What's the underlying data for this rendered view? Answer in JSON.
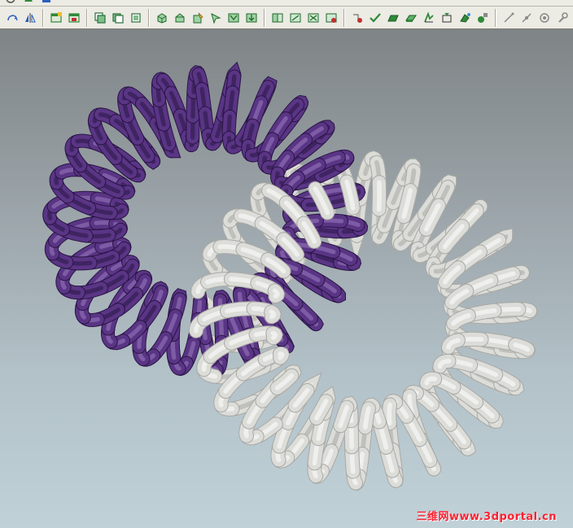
{
  "window": {
    "background": "#808890"
  },
  "toolbar": {
    "background": "#ecebe4",
    "groups": [
      {
        "name": "transform-tools",
        "items": [
          {
            "name": "rotate-arc-icon",
            "color": "#2a5dbf"
          },
          {
            "name": "mirror-icon",
            "color": "#2a5dbf"
          }
        ]
      },
      {
        "name": "window-tools",
        "items": [
          {
            "name": "new-window-icon",
            "color": "#2f8a3a"
          },
          {
            "name": "save-view-icon",
            "color": "#2f8a3a"
          }
        ]
      },
      {
        "name": "layer-tools",
        "items": [
          {
            "name": "stack-layer-icon",
            "color": "#2a6e3b"
          },
          {
            "name": "overlap-layer-icon",
            "color": "#2a6e3b"
          },
          {
            "name": "single-layer-icon",
            "color": "#2a6e3b"
          }
        ]
      },
      {
        "name": "solid-tools",
        "items": [
          {
            "name": "box-solid-icon",
            "color": "#2f8a3a"
          },
          {
            "name": "cut-solid-icon",
            "color": "#2f8a3a"
          },
          {
            "name": "edit-solid-icon",
            "color": "#2f8a3a"
          },
          {
            "name": "arrow-solid-icon",
            "color": "#2f8a3a"
          },
          {
            "name": "shell-solid-icon",
            "color": "#2f8a3a"
          },
          {
            "name": "extract-solid-icon",
            "color": "#2f8a3a"
          }
        ]
      },
      {
        "name": "boolean-tools",
        "items": [
          {
            "name": "union-icon",
            "color": "#2f8a3a"
          },
          {
            "name": "subtract-icon",
            "color": "#2f8a3a"
          },
          {
            "name": "intersect-icon",
            "color": "#2f8a3a"
          },
          {
            "name": "separate-icon",
            "color": "#c03030"
          }
        ]
      },
      {
        "name": "surface-tools",
        "items": [
          {
            "name": "point-surface-icon",
            "color": "#c03030"
          },
          {
            "name": "check-surface-icon",
            "color": "#2f8a3a"
          },
          {
            "name": "loft-surface-icon",
            "color": "#2f8a3a"
          },
          {
            "name": "sweep-surface-icon",
            "color": "#2f8a3a"
          },
          {
            "name": "revolve-surface-icon",
            "color": "#2f8a3a"
          },
          {
            "name": "offset-surface-icon",
            "color": "#2f8a3a"
          },
          {
            "name": "blend-surface-icon",
            "color": "#2f8a3a"
          },
          {
            "name": "trim-surface-icon",
            "color": "#2f8a3a"
          }
        ]
      },
      {
        "name": "analysis-tools",
        "items": [
          {
            "name": "line-measure-icon",
            "color": "#8a8a8a"
          },
          {
            "name": "angle-measure-icon",
            "color": "#8a8a8a"
          },
          {
            "name": "circle-measure-icon",
            "color": "#8a8a8a"
          },
          {
            "name": "wrench-icon",
            "color": "#8a8a8a"
          }
        ]
      }
    ]
  },
  "viewport": {
    "background_top": "#7f8486",
    "background_bottom": "#c0d1d8"
  },
  "scene": {
    "objects": [
      {
        "name": "purple-coil-ring",
        "color_base": "#5a3585",
        "color_light": "#9a7ac0",
        "color_dark": "#2a1545"
      },
      {
        "name": "white-coil-ring",
        "color_base": "#dcdcd8",
        "color_light": "#ffffff",
        "color_dark": "#a8a8a4"
      }
    ]
  },
  "watermark": {
    "text": "三维网www.3dportal.cn",
    "color": "#ff2030"
  }
}
